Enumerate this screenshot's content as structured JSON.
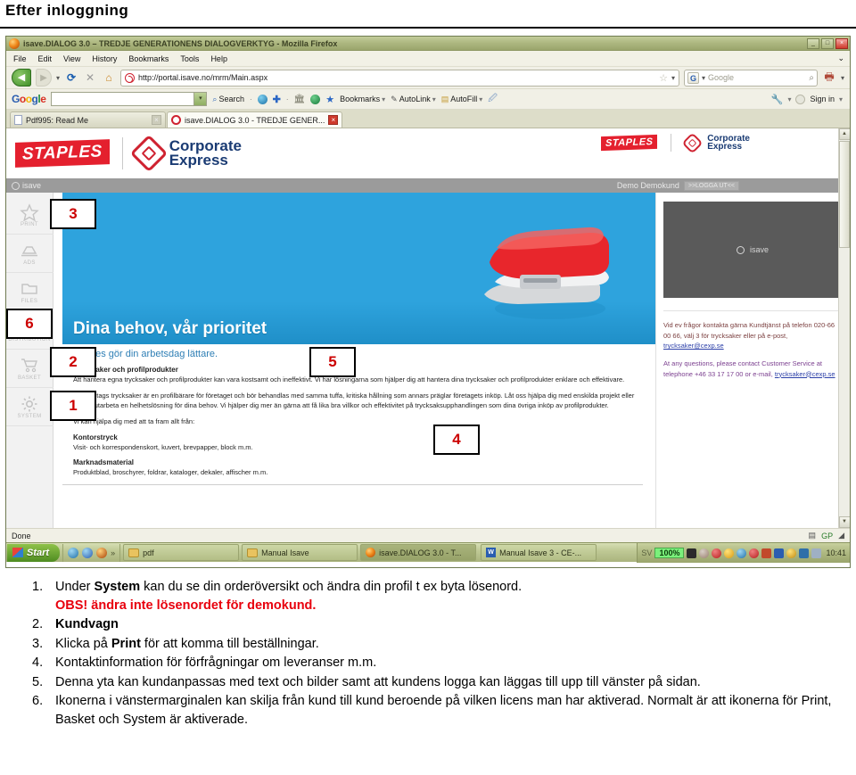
{
  "document": {
    "heading": "Efter inloggning"
  },
  "browser": {
    "window_title": "isave.DIALOG 3.0 – TREDJE GENERATIONENS DIALOGVERKTYG - Mozilla Firefox",
    "window_buttons": {
      "minimize": "_",
      "maximize": "□",
      "close": "×"
    },
    "menu": [
      "File",
      "Edit",
      "View",
      "History",
      "Bookmarks",
      "Tools",
      "Help"
    ],
    "nav": {
      "back_icon": "◀",
      "forward_icon": "▶",
      "dropdown_icon": "▾",
      "reload_icon": "⟳",
      "stop_icon": "✕",
      "home_icon": "⌂",
      "url": "http://portal.isave.no/mrm/Main.aspx",
      "bookmark_star_icon": "☆",
      "search_placeholder": "Google",
      "search_engine_badge": "G",
      "search_go_icon": "🔍"
    },
    "google_toolbar": {
      "logo_letters": [
        "G",
        "o",
        "o",
        "g",
        "l",
        "e"
      ],
      "input_value": "",
      "dropdown_icon": "▾",
      "items": [
        {
          "label": "Search",
          "icon": "search-icon"
        },
        {
          "label": "Bookmarks",
          "icon": "star-icon"
        },
        {
          "label": "AutoLink",
          "icon": "autolink-icon"
        },
        {
          "label": "AutoFill",
          "icon": "autofill-icon"
        }
      ],
      "sign_in": "Sign in"
    },
    "tabs": [
      {
        "label": "Pdf995: Read Me",
        "active": false
      },
      {
        "label": "isave.DIALOG 3.0 - TREDJE GENER...",
        "active": true
      }
    ],
    "status": "Done"
  },
  "site": {
    "brand": {
      "staples": "STAPLES",
      "corporate": "Corporate",
      "express": "Express"
    },
    "appbar": {
      "app_name": "isave",
      "user": "Demo Demokund",
      "logout": ">>LOGGA UT<<"
    },
    "sidebar": [
      {
        "label": "PRINT",
        "icon": "star-icon"
      },
      {
        "label": "ADS",
        "icon": "megaphone-icon"
      },
      {
        "label": "FILES",
        "icon": "folder-icon"
      },
      {
        "label": "DISTRIBUTION",
        "icon": "truck-icon"
      },
      {
        "label": "BASKET",
        "icon": "shopping-cart-icon"
      },
      {
        "label": "SYSTEM",
        "icon": "gear-icon"
      }
    ],
    "hero": {
      "title": "Dina behov, vår prioritet",
      "subtitle": "Staples gör din arbetsdag lättare."
    },
    "body": {
      "h1": "Trycksaker och profilprodukter",
      "p1": "Att hantera egna trycksaker och profilprodukter kan vara kostsamt och ineffektivt. Vi har lösningarna som hjälper dig att hantera dina trycksaker och profilprodukter enklare och effektivare.",
      "p2": "Ditt företags trycksaker är en profilbärare för företaget och bör behandlas med samma tuffa, kritiska hållning som annars präglar företagets inköp. Låt oss hjälpa dig med enskilda projekt eller låt oss utarbeta en helhetslösning för dina behov. Vi hjälper dig mer än gärna att få lika bra villkor och effektivitet på trycksaksupphandlingen som dina övriga inköp av profilprodukter.",
      "p3": "Vi kan hjälpa dig med att ta fram allt från:",
      "h2": "Kontorstryck",
      "p4": "Visit- och korrespondenskort, kuvert, brevpapper, block m.m.",
      "h3": "Marknadsmaterial",
      "p5": "Produktblad, broschyrer, foldrar, kataloger, dekaler, affischer m.m."
    },
    "right_panel": {
      "logo_slot_label": "isave",
      "contact_sv": "Vid ev frågor kontakta gärna Kundtjänst på telefon 020-66 00 66, välj 3 för trycksaker eller på e-post,",
      "contact_sv_email": "trycksaker@cexp.se",
      "contact_en": "At any questions, please contact Customer Service at telephone +46 33 17 17 00 or e-mail,",
      "contact_en_email": "trycksaker@cexp.se"
    },
    "scroll": {
      "up_icon": "▲",
      "down_icon": "▼"
    }
  },
  "taskbar": {
    "start": "Start",
    "quick_more": "»",
    "tasks": [
      {
        "label": "pdf",
        "icon": "folder-icon",
        "active": false
      },
      {
        "label": "Manual Isave",
        "icon": "folder-icon",
        "active": false
      },
      {
        "label": "isave.DIALOG 3.0 - T...",
        "icon": "firefox-icon",
        "active": true
      },
      {
        "label": "Manual Isave 3 - CE-...",
        "icon": "word-icon",
        "active": false
      }
    ],
    "tray": {
      "language": "SV",
      "zoom": "100%",
      "clock": "10:41"
    }
  },
  "callouts": [
    {
      "id": "1",
      "label": "1"
    },
    {
      "id": "2",
      "label": "2"
    },
    {
      "id": "3",
      "label": "3"
    },
    {
      "id": "4",
      "label": "4"
    },
    {
      "id": "5",
      "label": "5"
    },
    {
      "id": "6",
      "label": "6"
    }
  ],
  "instructions": [
    {
      "num": "1.",
      "pre": "Under ",
      "bold": "System",
      "post": " kan du se din orderöversikt och ändra din profil t ex byta lösenord.",
      "warning": "OBS! ändra inte lösenordet för demokund."
    },
    {
      "num": "2.",
      "pre": "",
      "bold": "Kundvagn",
      "post": "",
      "warning": ""
    },
    {
      "num": "3.",
      "pre": "Klicka på ",
      "bold": "Print",
      "post": " för att komma till beställningar.",
      "warning": ""
    },
    {
      "num": "4.",
      "pre": "Kontaktinformation för förfrågningar om leveranser m.m.",
      "bold": "",
      "post": "",
      "warning": ""
    },
    {
      "num": "5.",
      "pre": "Denna yta kan kundanpassas med text och bilder samt att kundens logga kan läggas till upp till vänster på sidan.",
      "bold": "",
      "post": "",
      "warning": ""
    },
    {
      "num": "6.",
      "pre": "Ikonerna i vänstermarginalen kan skilja från kund till kund beroende på vilken licens man har aktiverad. Normalt är att ikonerna för Print, Basket och System är aktiverade.",
      "bold": "",
      "post": "",
      "warning": ""
    }
  ]
}
